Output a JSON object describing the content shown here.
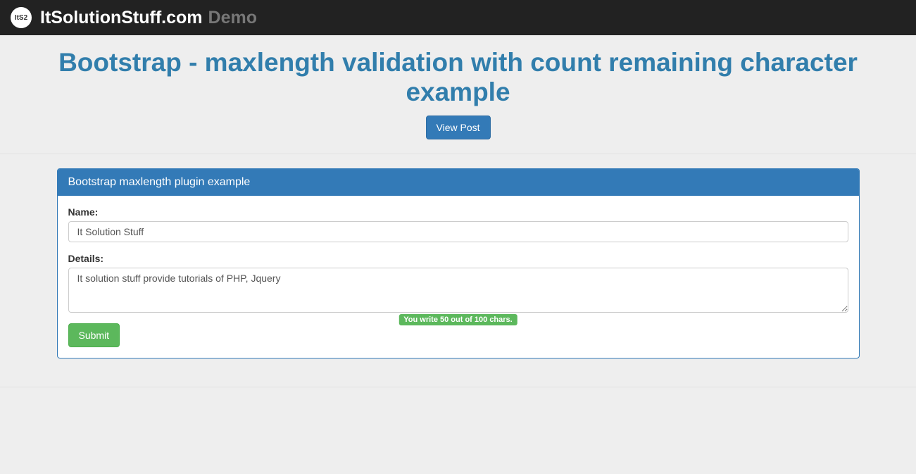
{
  "navbar": {
    "logo_text": "ItS2",
    "brand": "ItSolutionStuff.com",
    "demo_label": "Demo"
  },
  "page": {
    "title": "Bootstrap - maxlength validation with count remaining character example",
    "view_post_label": "View Post"
  },
  "panel": {
    "heading": "Bootstrap maxlength plugin example"
  },
  "form": {
    "name_label": "Name:",
    "name_value": "It Solution Stuff",
    "details_label": "Details:",
    "details_value": "It solution stuff provide tutorials of PHP, Jquery",
    "char_counter": "You write 50 out of 100 chars.",
    "submit_label": "Submit"
  }
}
